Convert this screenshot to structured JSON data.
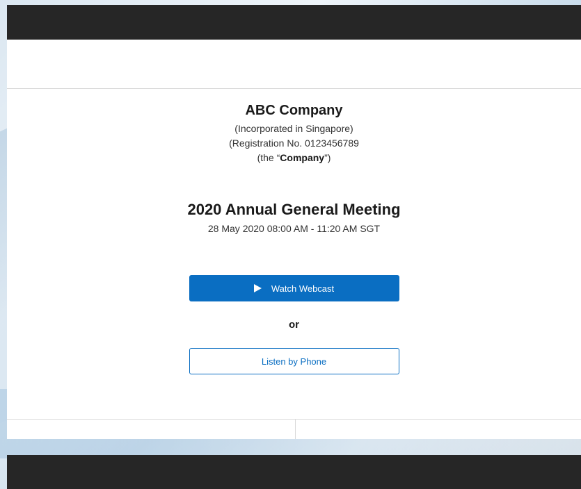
{
  "company": {
    "name": "ABC Company",
    "incorporation": "(Incorporated in Singapore)",
    "registration": "(Registration No. 0123456789",
    "defined_prefix": "(the “",
    "defined_term": "Company",
    "defined_suffix": "”)"
  },
  "meeting": {
    "title": "2020 Annual General Meeting",
    "time": "28 May 2020 08:00 AM - 11:20 AM SGT"
  },
  "actions": {
    "watch_label": "Watch Webcast",
    "watch_icon": "play-icon",
    "or_label": "or",
    "phone_label": "Listen by Phone"
  },
  "colors": {
    "accent": "#0a6ec2",
    "dark_bar": "#262626"
  }
}
